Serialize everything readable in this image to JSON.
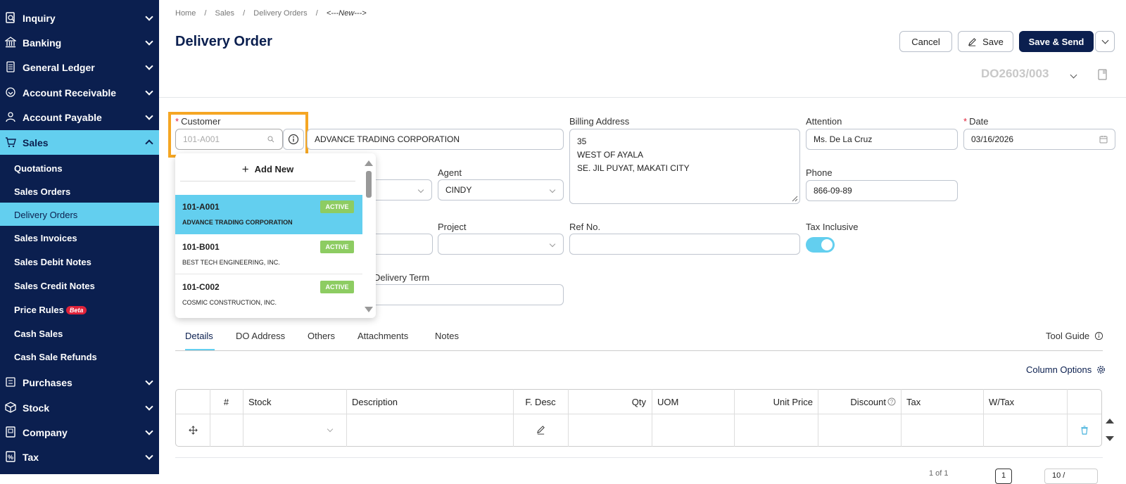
{
  "sidebar": {
    "main_top": [
      {
        "label": "Inquiry",
        "icon": "inquiry-icon"
      },
      {
        "label": "Banking",
        "icon": "bank-icon"
      },
      {
        "label": "General Ledger",
        "icon": "ledger-icon"
      },
      {
        "label": "Account Receivable",
        "icon": "receivable-icon"
      },
      {
        "label": "Account Payable",
        "icon": "payable-icon"
      },
      {
        "label": "Sales",
        "icon": "cart-icon"
      }
    ],
    "sales_sub": [
      "Quotations",
      "Sales Orders",
      "Delivery Orders",
      "Sales Invoices",
      "Sales Debit Notes",
      "Sales Credit Notes",
      "Price Rules",
      "Cash Sales",
      "Cash Sale Refunds"
    ],
    "beta_label": "Beta",
    "main_bottom": [
      {
        "label": "Purchases",
        "icon": "purchase-icon"
      },
      {
        "label": "Stock",
        "icon": "box-icon"
      },
      {
        "label": "Company",
        "icon": "company-icon"
      },
      {
        "label": "Tax",
        "icon": "tax-icon"
      }
    ]
  },
  "breadcrumb": {
    "home": "Home",
    "sales": "Sales",
    "delivery_orders": "Delivery Orders",
    "current": "<---New--->"
  },
  "page": {
    "title": "Delivery Order",
    "doc_no": "DO2603/003"
  },
  "actions": {
    "cancel": "Cancel",
    "save": "Save",
    "save_send": "Save & Send"
  },
  "form": {
    "customer_label": "Customer",
    "customer_placeholder": "101-A001",
    "customer_name": "ADVANCE TRADING CORPORATION",
    "billing_label": "Billing Address",
    "billing_lines": [
      "35",
      "WEST OF AYALA",
      "SE. JIL PUYAT, MAKATI CITY"
    ],
    "attention_label": "Attention",
    "attention_value": "Ms. De La Cruz",
    "date_label": "Date",
    "date_value": "03/16/2026",
    "agent_label": "Agent",
    "agent_value": "CINDY",
    "phone_label": "Phone",
    "phone_value": "866-09-89",
    "project_label": "Project",
    "refno_label": "Ref No.",
    "tax_label": "Tax Inclusive",
    "tax_on": true,
    "delivery_term_label": "Delivery Term"
  },
  "dropdown": {
    "add_new": "Add New",
    "items": [
      {
        "code": "101-A001",
        "name": "ADVANCE TRADING CORPORATION",
        "status": "ACTIVE"
      },
      {
        "code": "101-B001",
        "name": "BEST TECH ENGINEERING, INC.",
        "status": "ACTIVE"
      },
      {
        "code": "101-C002",
        "name": "COSMIC CONSTRUCTION, INC.",
        "status": "ACTIVE"
      }
    ]
  },
  "tabs": [
    "Details",
    "DO Address",
    "Others",
    "Attachments",
    "Notes"
  ],
  "tool_guide": "Tool Guide",
  "column_options": "Column Options",
  "table": {
    "headers": [
      "#",
      "Stock",
      "Description",
      "F. Desc",
      "Qty",
      "UOM",
      "Unit Price",
      "Discount",
      "Tax",
      "W/Tax"
    ]
  },
  "footer": {
    "page": "1",
    "pager_text": "1 of 1",
    "page_size": "10 /"
  },
  "colors": {
    "sidebar": "#0b1f4f",
    "accent": "#63cfef",
    "primary_button": "#0b1f4f",
    "highlight": "#f5a623",
    "badge": "#8dcc62"
  }
}
